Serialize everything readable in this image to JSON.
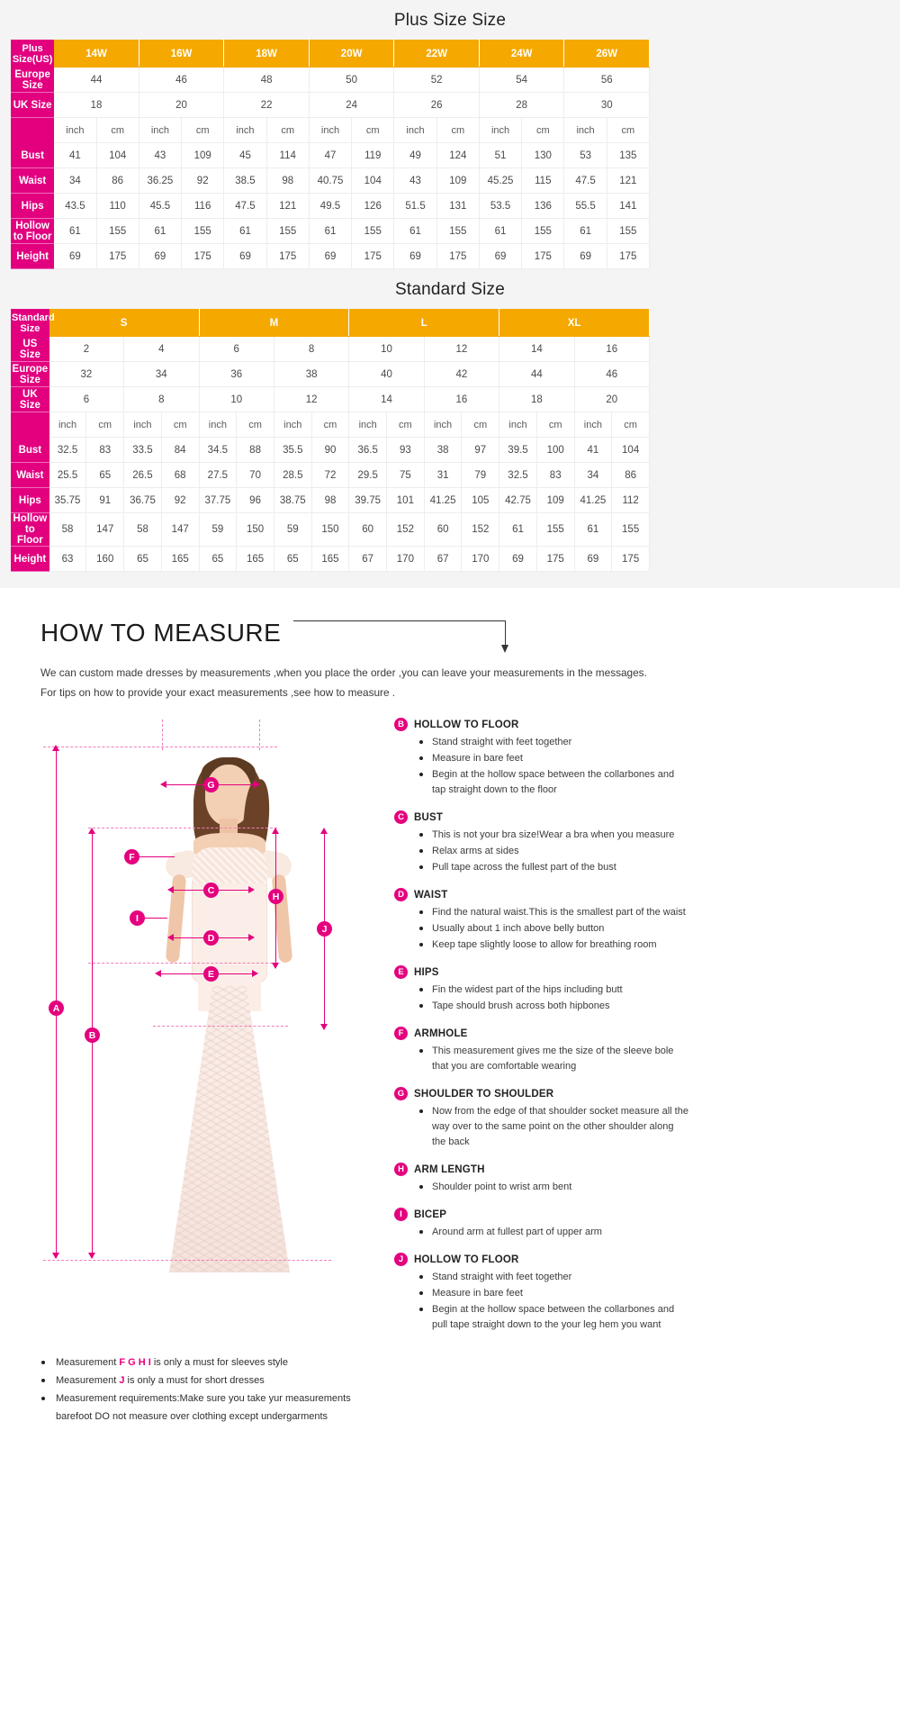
{
  "plus_table": {
    "title": "Plus Size Size",
    "corner_label": "Plus Size(US)",
    "group_headers": [
      "14W",
      "16W",
      "18W",
      "20W",
      "22W",
      "24W",
      "26W"
    ],
    "simple_rows": [
      {
        "label": "Europe Size",
        "values": [
          "44",
          "46",
          "48",
          "50",
          "52",
          "54",
          "56"
        ]
      },
      {
        "label": "UK Size",
        "values": [
          "18",
          "20",
          "22",
          "24",
          "26",
          "28",
          "30"
        ]
      }
    ],
    "unit_row": {
      "label": "",
      "units": [
        "inch",
        "cm",
        "inch",
        "cm",
        "inch",
        "cm",
        "inch",
        "cm",
        "inch",
        "cm",
        "inch",
        "cm",
        "inch",
        "cm"
      ]
    },
    "measure_rows": [
      {
        "label": "Bust",
        "values": [
          "41",
          "104",
          "43",
          "109",
          "45",
          "114",
          "47",
          "119",
          "49",
          "124",
          "51",
          "130",
          "53",
          "135"
        ]
      },
      {
        "label": "Waist",
        "values": [
          "34",
          "86",
          "36.25",
          "92",
          "38.5",
          "98",
          "40.75",
          "104",
          "43",
          "109",
          "45.25",
          "115",
          "47.5",
          "121"
        ]
      },
      {
        "label": "Hips",
        "values": [
          "43.5",
          "110",
          "45.5",
          "116",
          "47.5",
          "121",
          "49.5",
          "126",
          "51.5",
          "131",
          "53.5",
          "136",
          "55.5",
          "141"
        ]
      },
      {
        "label": "Hollow to Floor",
        "values": [
          "61",
          "155",
          "61",
          "155",
          "61",
          "155",
          "61",
          "155",
          "61",
          "155",
          "61",
          "155",
          "61",
          "155"
        ]
      },
      {
        "label": "Height",
        "values": [
          "69",
          "175",
          "69",
          "175",
          "69",
          "175",
          "69",
          "175",
          "69",
          "175",
          "69",
          "175",
          "69",
          "175"
        ]
      }
    ]
  },
  "standard_table": {
    "title": "Standard Size",
    "corner_label": "Standard Size",
    "group_headers": [
      "S",
      "M",
      "L",
      "XL"
    ],
    "simple_rows": [
      {
        "label": "US Size",
        "values": [
          "2",
          "4",
          "6",
          "8",
          "10",
          "12",
          "14",
          "16"
        ]
      },
      {
        "label": "Europe Size",
        "values": [
          "32",
          "34",
          "36",
          "38",
          "40",
          "42",
          "44",
          "46"
        ]
      },
      {
        "label": "UK Size",
        "values": [
          "6",
          "8",
          "10",
          "12",
          "14",
          "16",
          "18",
          "20"
        ]
      }
    ],
    "unit_row": {
      "label": "",
      "units": [
        "inch",
        "cm",
        "inch",
        "cm",
        "inch",
        "cm",
        "inch",
        "cm",
        "inch",
        "cm",
        "inch",
        "cm",
        "inch",
        "cm",
        "inch",
        "cm"
      ]
    },
    "measure_rows": [
      {
        "label": "Bust",
        "values": [
          "32.5",
          "83",
          "33.5",
          "84",
          "34.5",
          "88",
          "35.5",
          "90",
          "36.5",
          "93",
          "38",
          "97",
          "39.5",
          "100",
          "41",
          "104"
        ]
      },
      {
        "label": "Waist",
        "values": [
          "25.5",
          "65",
          "26.5",
          "68",
          "27.5",
          "70",
          "28.5",
          "72",
          "29.5",
          "75",
          "31",
          "79",
          "32.5",
          "83",
          "34",
          "86"
        ]
      },
      {
        "label": "Hips",
        "values": [
          "35.75",
          "91",
          "36.75",
          "92",
          "37.75",
          "96",
          "38.75",
          "98",
          "39.75",
          "101",
          "41.25",
          "105",
          "42.75",
          "109",
          "41.25",
          "112"
        ]
      },
      {
        "label": "Hollow to Floor",
        "values": [
          "58",
          "147",
          "58",
          "147",
          "59",
          "150",
          "59",
          "150",
          "60",
          "152",
          "60",
          "152",
          "61",
          "155",
          "61",
          "155"
        ]
      },
      {
        "label": "Height",
        "values": [
          "63",
          "160",
          "65",
          "165",
          "65",
          "165",
          "65",
          "165",
          "67",
          "170",
          "67",
          "170",
          "69",
          "175",
          "69",
          "175"
        ]
      }
    ]
  },
  "how_to_measure": {
    "title": "HOW TO MEASURE",
    "intro_line1": "We can custom made dresses by measurements ,when you place the order ,you can leave your measurements in the messages.",
    "intro_line2": "For tips on how to provide your exact measurements ,see how to measure ."
  },
  "figure_labels": [
    "A",
    "B",
    "C",
    "D",
    "E",
    "F",
    "G",
    "H",
    "I",
    "J"
  ],
  "notes": [
    {
      "letter": "B",
      "title": "HOLLOW TO FLOOR",
      "bullets": [
        "Stand straight with feet together",
        "Measure in bare feet",
        "Begin at the hollow space between the  collarbones and tap straight down to the floor"
      ]
    },
    {
      "letter": "C",
      "title": "BUST",
      "bullets": [
        "This is not your bra size!Wear a bra when you measure",
        "Relax arms at sides",
        "Pull tape across the fullest part of the bust"
      ]
    },
    {
      "letter": "D",
      "title": "WAIST",
      "bullets": [
        "Find the natural waist.This is the smallest part of the waist",
        "Usually about 1 inch above belly button",
        "Keep tape slightly loose to allow for breathing room"
      ]
    },
    {
      "letter": "E",
      "title": "HIPS",
      "bullets": [
        "Fin the widest part of the hips including butt",
        "Tape should brush across both hipbones"
      ]
    },
    {
      "letter": "F",
      "title": "ARMHOLE",
      "bullets": [
        "This measurement gives me the size of the sleeve bole that you are comfortable wearing"
      ]
    },
    {
      "letter": "G",
      "title": "SHOULDER TO SHOULDER",
      "bullets": [
        "Now from the edge of that shoulder socket measure all the way over to the same point on the other shoulder along the back"
      ]
    },
    {
      "letter": "H",
      "title": "ARM LENGTH",
      "bullets": [
        "Shoulder point to wrist arm bent"
      ]
    },
    {
      "letter": "I",
      "title": "BICEP",
      "bullets": [
        "Around arm at fullest part of upper arm"
      ]
    },
    {
      "letter": "J",
      "title": "HOLLOW TO FLOOR",
      "bullets": [
        "Stand straight with feet together",
        "Measure in bare feet",
        "Begin at the hollow space between the collarbones and pull tape straight down to the your leg hem you want"
      ]
    }
  ],
  "footnotes": [
    {
      "pre": "Measurement ",
      "pink": "F G H I",
      "post": " is only a must for sleeves style"
    },
    {
      "pre": "Measurement ",
      "pink": "J",
      "post": " is only a must for short dresses"
    },
    {
      "pre": "Measurement requirements:Make sure you take yur measurements",
      "pink": "",
      "post": ""
    }
  ],
  "footnote_sub": "barefoot DO not measure over clothing except undergarments",
  "colors": {
    "pink": "#e2007f",
    "orange": "#f5a800",
    "badge_pink": "#e5007e",
    "table_bg": "#f4f4f4"
  }
}
